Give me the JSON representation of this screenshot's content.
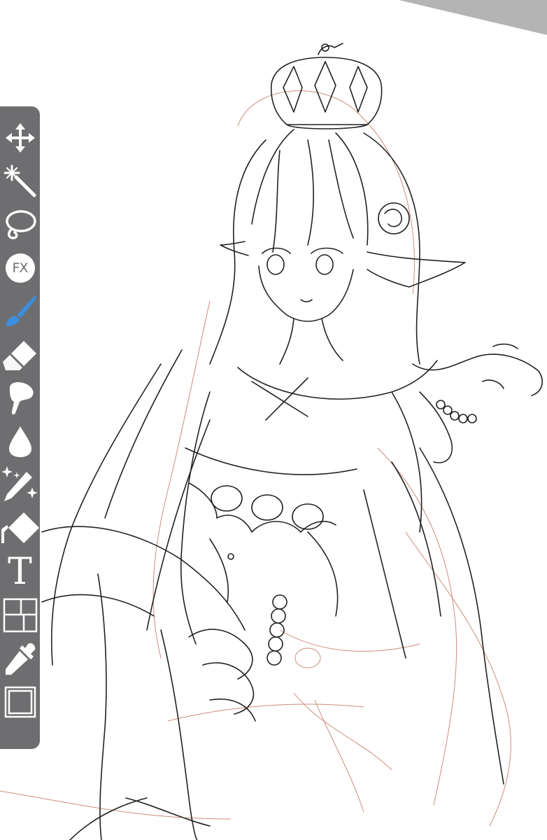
{
  "app": {
    "accent_color": "#3b8fde",
    "toolbar_color": "#6e6e70",
    "canvas_color": "#ffffff",
    "sketch_line_color": "#222222",
    "sketch_guide_color": "#c0705a"
  },
  "toolbar": {
    "tools": [
      {
        "name": "transform",
        "icon": "move-arrows-icon",
        "active": false
      },
      {
        "name": "magic-wand",
        "icon": "magic-wand-icon",
        "active": false
      },
      {
        "name": "lasso",
        "icon": "lasso-icon",
        "active": false
      },
      {
        "name": "fx",
        "icon": "fx-icon",
        "label": "FX",
        "active": false
      },
      {
        "name": "brush",
        "icon": "brush-icon",
        "active": true
      },
      {
        "name": "eraser",
        "icon": "eraser-icon",
        "active": false
      },
      {
        "name": "smudge",
        "icon": "smudge-icon",
        "active": false
      },
      {
        "name": "blur",
        "icon": "water-drop-icon",
        "active": false
      },
      {
        "name": "sparkle-brush",
        "icon": "sparkle-pen-icon",
        "active": false
      },
      {
        "name": "fill",
        "icon": "fill-diamond-icon",
        "active": false
      },
      {
        "name": "text",
        "icon": "text-icon",
        "label": "T",
        "active": false
      },
      {
        "name": "frames",
        "icon": "frames-icon",
        "active": false
      },
      {
        "name": "eyedropper",
        "icon": "eyedropper-icon",
        "active": false
      },
      {
        "name": "layer",
        "icon": "layer-square-icon",
        "active": false
      }
    ]
  }
}
